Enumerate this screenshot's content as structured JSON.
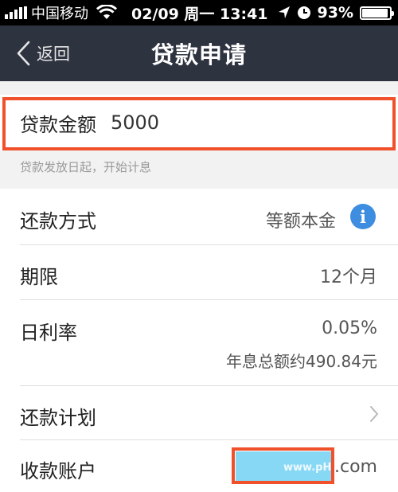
{
  "status_bar": {
    "carrier": "中国移动",
    "datetime": "02/09 周一 13:41",
    "battery": "93%",
    "battery_level": 0.93,
    "icons": [
      "signal-icon",
      "wifi-icon",
      "location-arrow-icon",
      "alarm-icon",
      "battery-icon"
    ]
  },
  "nav": {
    "back_label": "返回",
    "title": "贷款申请"
  },
  "amount": {
    "label": "贷款金额",
    "value": "5000",
    "hint": "贷款发放日起，开始计息"
  },
  "rows": {
    "repayment_method": {
      "label": "还款方式",
      "value": "等额本金",
      "info_icon": "i"
    },
    "term": {
      "label": "期限",
      "value": "12个月"
    },
    "daily_rate": {
      "label": "日利率",
      "value": "0.05%",
      "sub": "年息总额约490.84元"
    },
    "repayment_plan": {
      "label": "还款计划"
    },
    "payee_account": {
      "label": "收款账户",
      "watermark": "www.pH",
      "suffix": ".com"
    }
  },
  "colors": {
    "nav_bg": "#2e3340",
    "highlight": "#f0502a",
    "info_blue": "#3d8de0",
    "mask_blue": "#87d8f5"
  }
}
